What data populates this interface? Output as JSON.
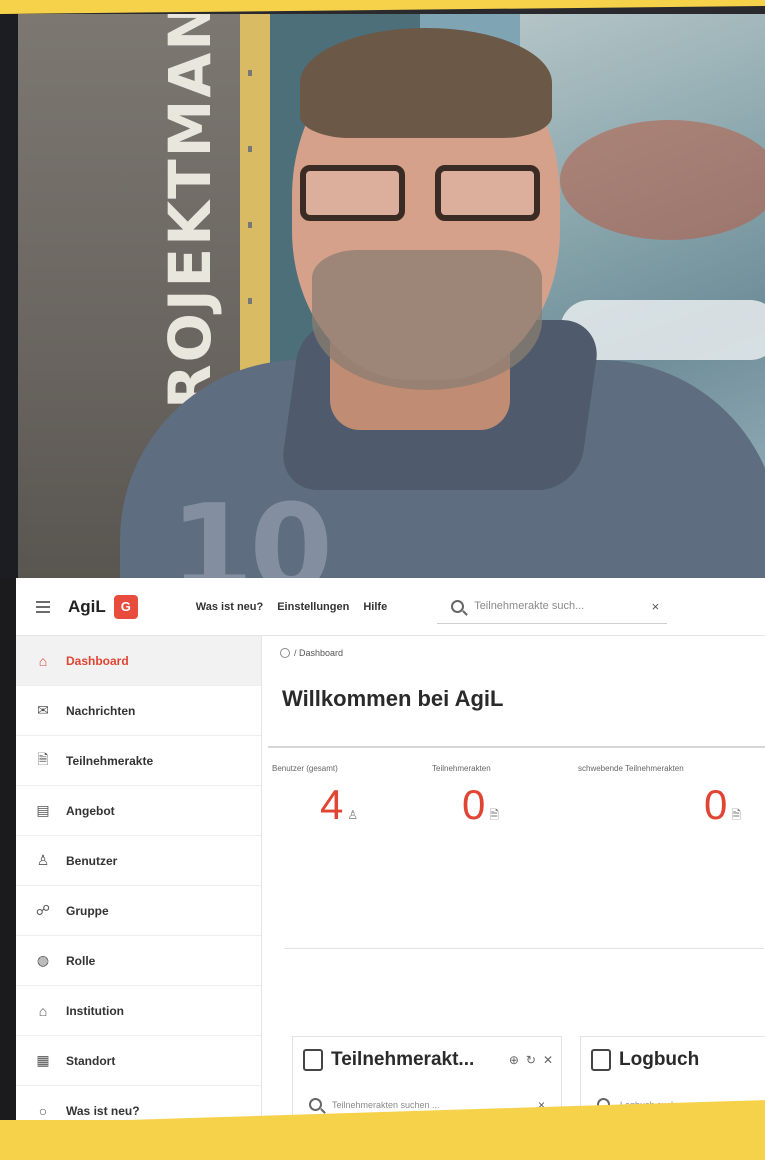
{
  "photo": {
    "poster_text": "ROJEKTMAN",
    "shirt_print": "10"
  },
  "app": {
    "brand": "AgiL",
    "brand_logo": "G",
    "top_nav": [
      "Was ist neu?",
      "Einstellungen",
      "Hilfe"
    ],
    "search": {
      "placeholder": "Teilnehmerakte such...",
      "clear": "×"
    }
  },
  "sidebar": {
    "items": [
      {
        "label": "Dashboard",
        "icon": "home-icon",
        "glyph": "⌂",
        "active": true
      },
      {
        "label": "Nachrichten",
        "icon": "mail-icon",
        "glyph": "✉",
        "active": false
      },
      {
        "label": "Teilnehmerakte",
        "icon": "file-icon",
        "glyph": "🗎",
        "active": false
      },
      {
        "label": "Angebot",
        "icon": "offer-icon",
        "glyph": "▤",
        "active": false
      },
      {
        "label": "Benutzer",
        "icon": "user-icon",
        "glyph": "♙",
        "active": false
      },
      {
        "label": "Gruppe",
        "icon": "group-icon",
        "glyph": "☍",
        "active": false
      },
      {
        "label": "Rolle",
        "icon": "role-icon",
        "glyph": "◍",
        "active": false
      },
      {
        "label": "Institution",
        "icon": "institution-icon",
        "glyph": "⌂",
        "active": false
      },
      {
        "label": "Standort",
        "icon": "location-icon",
        "glyph": "▦",
        "active": false
      },
      {
        "label": "Was ist neu?",
        "icon": "whats-new-icon",
        "glyph": "○",
        "active": false
      }
    ]
  },
  "main": {
    "breadcrumb": "/ Dashboard",
    "title": "Willkommen bei AgiL",
    "stats": [
      {
        "label": "Benutzer (gesamt)",
        "value": "4"
      },
      {
        "label": "Teilnehmerakten",
        "value": "0"
      },
      {
        "label": "schwebende Teilnehmerakten",
        "value": "0"
      }
    ],
    "cards": [
      {
        "title": "Teilnehmerakt...",
        "search_placeholder": "Teilnehmerakten suchen ...",
        "clear": "×",
        "empty": "∅"
      },
      {
        "title": "Logbuch",
        "search_placeholder": "Logbuch suchen ...",
        "clear": "×",
        "empty": "∅"
      }
    ]
  },
  "colors": {
    "accent": "#e04433",
    "yellow": "#f6d24a"
  }
}
